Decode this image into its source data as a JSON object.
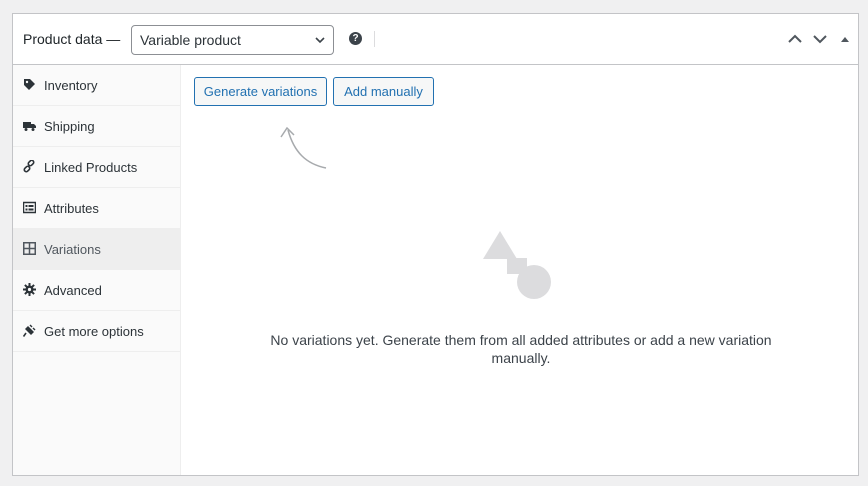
{
  "header": {
    "title": "Product data —",
    "product_type": "Variable product",
    "help_icon": "question-circle-icon"
  },
  "tabs": [
    {
      "label": "Inventory",
      "icon": "tag-icon"
    },
    {
      "label": "Shipping",
      "icon": "truck-icon"
    },
    {
      "label": "Linked Products",
      "icon": "link-icon"
    },
    {
      "label": "Attributes",
      "icon": "list-table-icon"
    },
    {
      "label": "Variations",
      "icon": "grid-icon",
      "active": true
    },
    {
      "label": "Advanced",
      "icon": "gear-icon"
    },
    {
      "label": "Get more options",
      "icon": "plug-icon"
    }
  ],
  "variations": {
    "generate_label": "Generate variations",
    "add_manually_label": "Add manually",
    "empty_message": "No variations yet. Generate them from all added attributes or add a new variation manually."
  },
  "colors": {
    "accent": "#2271b1",
    "border": "#c3c4c7",
    "tab_bg": "#fafafa",
    "active_tab_bg": "#eeeeee"
  }
}
